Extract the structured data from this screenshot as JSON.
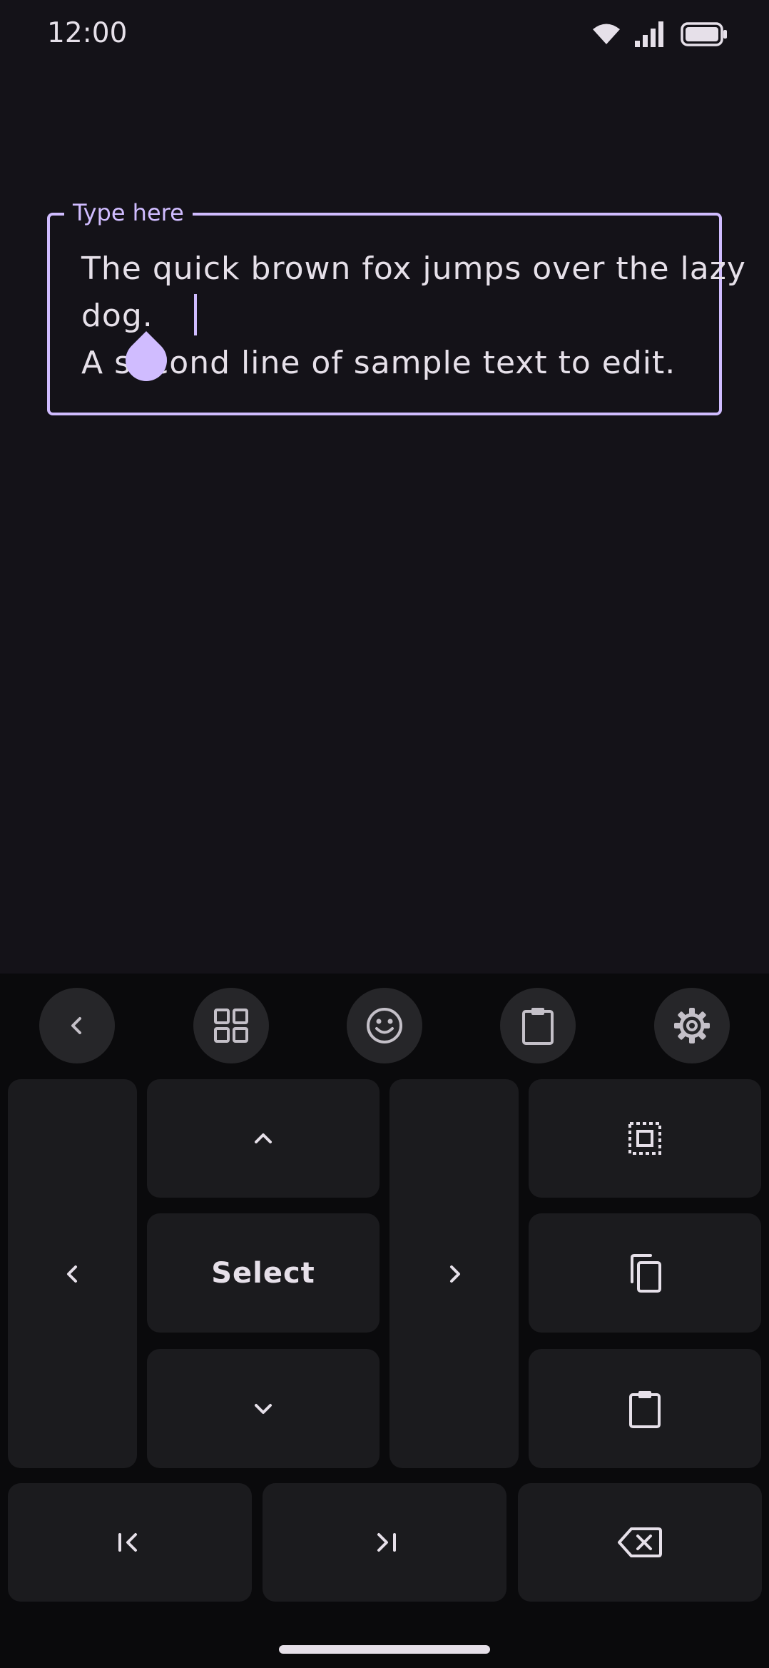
{
  "status_bar": {
    "time": "12:00",
    "icons": [
      "wifi-icon",
      "signal-icon",
      "battery-icon"
    ]
  },
  "text_field": {
    "label": "Type here",
    "lines": [
      "The quick brown fox jumps over the lazy",
      "dog.",
      "A second line of sample text to edit."
    ]
  },
  "keyboard": {
    "toolbar": [
      "back-icon",
      "grid-icon",
      "emoji-icon",
      "clipboard-icon",
      "settings-icon"
    ],
    "select_label": "Select",
    "keys": [
      "left-arrow",
      "up-arrow",
      "select",
      "down-arrow",
      "right-arrow",
      "select-all",
      "copy",
      "paste",
      "home",
      "end",
      "backspace"
    ]
  },
  "colors": {
    "background": "#141218",
    "accent": "#D0BCFF",
    "text": "#E6E0E9",
    "keyboard_bg": "#0A0A0C",
    "key_bg": "#1B1B1E",
    "toolbar_btn_bg": "#262629"
  }
}
